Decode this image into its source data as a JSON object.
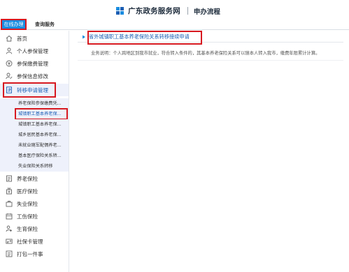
{
  "header": {
    "site_name": "广东政务服务网",
    "section_title": "申办流程"
  },
  "tabs": [
    {
      "label": "在线办理",
      "active": true
    },
    {
      "label": "查询服务",
      "active": false
    }
  ],
  "sidebar": {
    "items": [
      {
        "label": "首页",
        "icon": "home-icon"
      },
      {
        "label": "个人参保管理",
        "icon": "user-icon"
      },
      {
        "label": "参保缴费管理",
        "icon": "payment-icon"
      },
      {
        "label": "参保信息修改",
        "icon": "edit-icon"
      },
      {
        "label": "转移申请管理",
        "icon": "transfer-icon",
        "active": true
      },
      {
        "label": "养老保险",
        "icon": "pension-icon"
      },
      {
        "label": "医疗保险",
        "icon": "medical-icon"
      },
      {
        "label": "失业保险",
        "icon": "unemployment-icon"
      },
      {
        "label": "工伤保险",
        "icon": "injury-icon"
      },
      {
        "label": "生育保险",
        "icon": "maternity-icon"
      },
      {
        "label": "社保卡管理",
        "icon": "card-icon"
      },
      {
        "label": "打包一件事",
        "icon": "package-icon"
      }
    ],
    "sub_items": [
      {
        "label": "养老保险参保缴费凭..."
      },
      {
        "label": "城镇职工基本养老保...",
        "selected": true
      },
      {
        "label": "城镇职工基本养老保..."
      },
      {
        "label": "城乡居民基本养老保..."
      },
      {
        "label": "未就业随军配偶养老..."
      },
      {
        "label": "基本医疗保险关系转..."
      },
      {
        "label": "失业保险关系转移"
      }
    ]
  },
  "content": {
    "title": "省外城镇职工基本养老保险关系转移接续申请",
    "description": "业务说明：个人跨地区到我市就业，符合转入条件的，其基本养老保险关系可以随本人转入我市，缴费年限累计计算。"
  },
  "colors": {
    "brand_blue": "#1a8de0",
    "link_blue": "#1a5fb4",
    "highlight_red": "#d71920",
    "active_bg": "#eef1fb"
  }
}
